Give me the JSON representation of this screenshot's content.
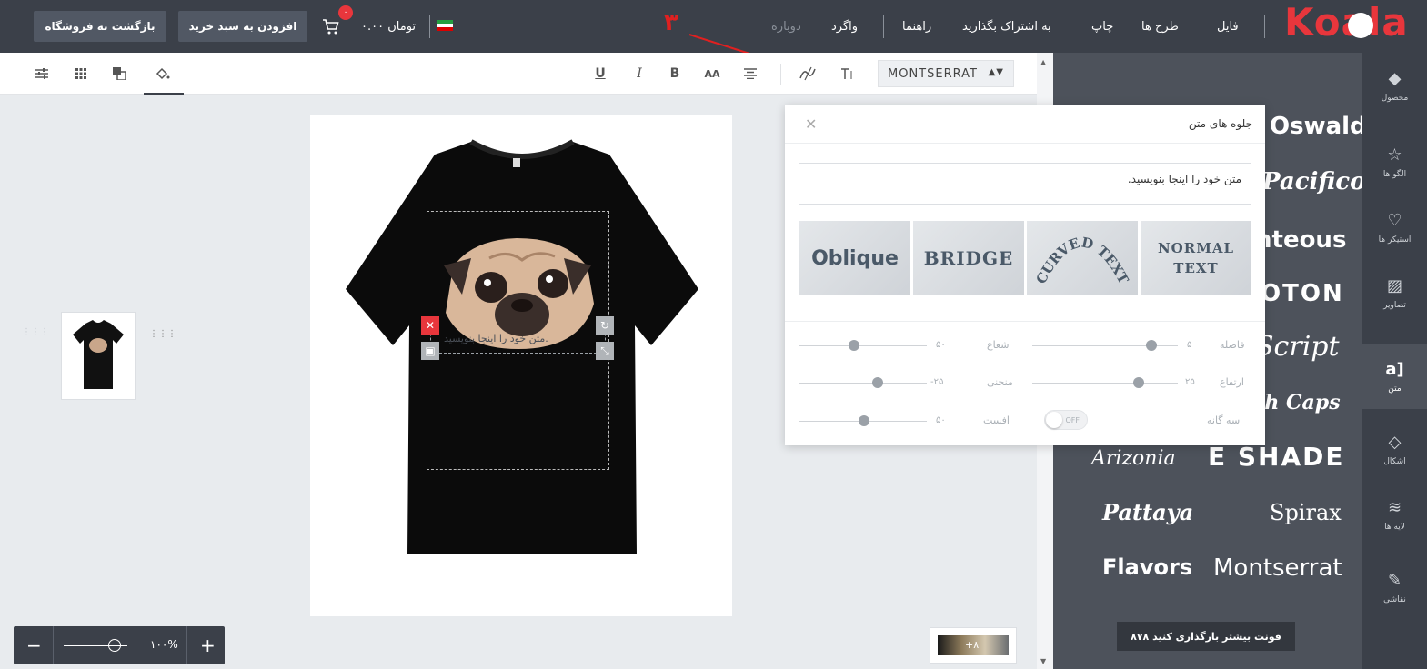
{
  "header": {
    "back_to_store": "بازگشت به فروشگاه",
    "add_to_cart": "افزودن به سبد خرید",
    "cart_total": "۰.۰۰ تومان",
    "cart_badge": "۰",
    "menu": {
      "file": "فایل",
      "designs": "طرح ها",
      "print": "چاپ",
      "share": "به اشتراک بگذارید",
      "help": "راهنما",
      "undo": "واگرد",
      "redo": "دوباره"
    },
    "logo": "Koala",
    "annotation": "۳"
  },
  "toolbar": {
    "font_name": "MONTSERRAT",
    "underline": "U",
    "italic": "I",
    "bold": "B",
    "case": "AA"
  },
  "canvas": {
    "text_placeholder": "متن خود را اینجا بنویسید.",
    "zoom_percent": "۱۰۰%",
    "zoom_level": 1.0,
    "swatch_label": "+۸"
  },
  "effects_popup": {
    "title": "جلوه های متن",
    "input_value": "متن خود را اینجا بنویسید.",
    "effects": [
      {
        "id": "oblique",
        "label": "Oblique"
      },
      {
        "id": "bridge",
        "label": "BRIDGE"
      },
      {
        "id": "curved",
        "label": "CURVED TEXT"
      },
      {
        "id": "normal",
        "label": "NORMAL TEXT"
      }
    ],
    "sliders": {
      "spacing": {
        "label": "فاصله",
        "value": "۵"
      },
      "radius": {
        "label": "شعاع",
        "value": "۵۰"
      },
      "height": {
        "label": "ارتفاع",
        "value": "۲۵"
      },
      "curve": {
        "label": "منحنی",
        "value": "-۲۵"
      },
      "triple": {
        "label": "سه گانه"
      },
      "offset": {
        "label": "افست",
        "value": "۵۰"
      }
    },
    "toggle_label": "OFF"
  },
  "font_panel": {
    "fonts": [
      "Oswald",
      "Pacifico",
      "nteous",
      "OTON",
      "Script",
      "sh Caps",
      "Arizonia",
      "E SHADE",
      "Pattaya",
      "Spirax",
      "Flavors",
      "Montserrat"
    ],
    "load_more": "۸۷۸ فونت بیشتر بارگذاری کنید"
  },
  "side_nav": [
    {
      "label": "محصول",
      "icon": "box-icon"
    },
    {
      "label": "الگو ها",
      "icon": "star-icon"
    },
    {
      "label": "استیکر ها",
      "icon": "heart-icon"
    },
    {
      "label": "تصاویر",
      "icon": "image-icon"
    },
    {
      "label": "متن",
      "icon": "text-icon"
    },
    {
      "label": "اشکال",
      "icon": "diamond-icon"
    },
    {
      "label": "لایه ها",
      "icon": "layers-icon"
    },
    {
      "label": "نقاشی",
      "icon": "pencil-icon"
    }
  ]
}
